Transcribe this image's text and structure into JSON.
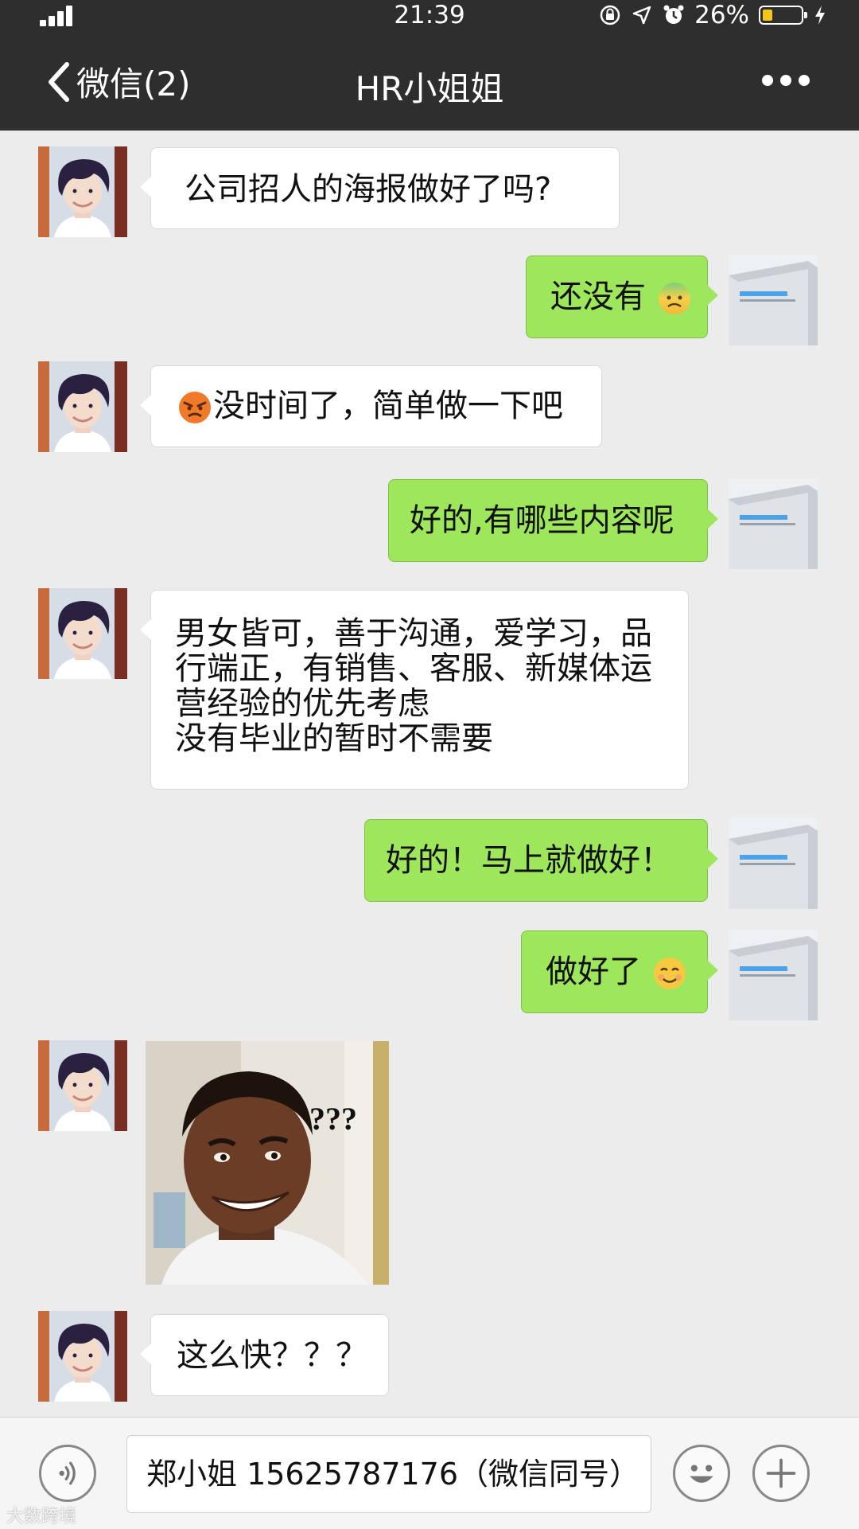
{
  "status_bar": {
    "time": "21:39",
    "battery_text": "26%",
    "battery_level": 0.26
  },
  "nav": {
    "back_label": "微信(2)",
    "title": "HR小姐姐"
  },
  "messages": [
    {
      "side": "left",
      "text": "公司招人的海报做好了吗?"
    },
    {
      "side": "right",
      "text": "还没有",
      "emoji": "worried-face-emoji"
    },
    {
      "side": "left",
      "text": "没时间了，简单做一下吧",
      "emoji": "angry-face-emoji"
    },
    {
      "side": "right",
      "text": "好的,有哪些内容呢"
    },
    {
      "side": "left",
      "text": "男女皆可，善于沟通，爱学习，品\n行端正，有销售、客服、新媒体运\n营经验的优先考虑\n没有毕业的暂时不需要"
    },
    {
      "side": "right",
      "text": "好的！马上就做好！"
    },
    {
      "side": "right",
      "text": "做好了",
      "emoji": "smiling-face-emoji"
    },
    {
      "side": "left",
      "sticker": "confused-man-sticker",
      "sticker_caption": "???"
    },
    {
      "side": "left",
      "text": "这么快？？？"
    }
  ],
  "input_bar": {
    "text": "郑小姐 15625787176（微信同号）"
  },
  "watermark": "大数跨境",
  "colors": {
    "bar_bg": "#2e2e2e",
    "chat_bg": "#ececec",
    "bubble_me": "#9ee75d",
    "bubble_peer": "#ffffff",
    "battery": "#f5c518"
  },
  "icons": [
    "signal-icon",
    "rotation-lock-icon",
    "location-arrow-icon",
    "alarm-clock-icon",
    "battery-icon",
    "charging-bolt-icon",
    "back-chevron-icon",
    "more-dots-icon",
    "voice-icon",
    "emoji-icon",
    "plus-icon"
  ]
}
